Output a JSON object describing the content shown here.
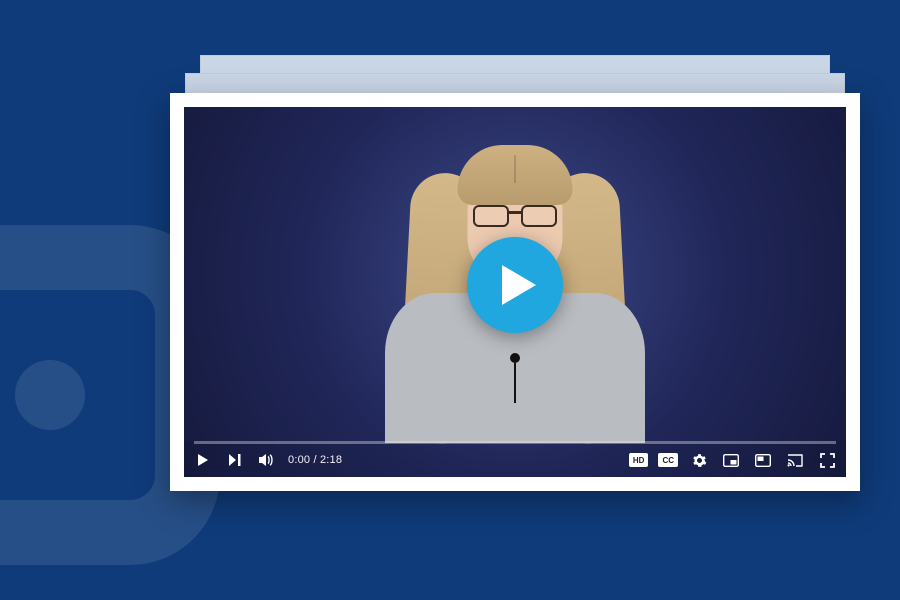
{
  "background": {
    "color": "#0f3b7a"
  },
  "player": {
    "accent": "#20a7e0",
    "time_current": "0:00",
    "time_total": "2:18",
    "time_display": "0:00 / 2:18",
    "cc_label": "CC",
    "hd_label": "HD",
    "icons": {
      "play_small": "play-icon",
      "next": "next-icon",
      "volume": "volume-icon",
      "captions": "captions-icon",
      "settings": "settings-icon",
      "miniplayer": "miniplayer-icon",
      "pip": "pip-icon",
      "cast": "cast-icon",
      "fullscreen": "fullscreen-icon",
      "play_overlay": "play-overlay-icon"
    }
  }
}
